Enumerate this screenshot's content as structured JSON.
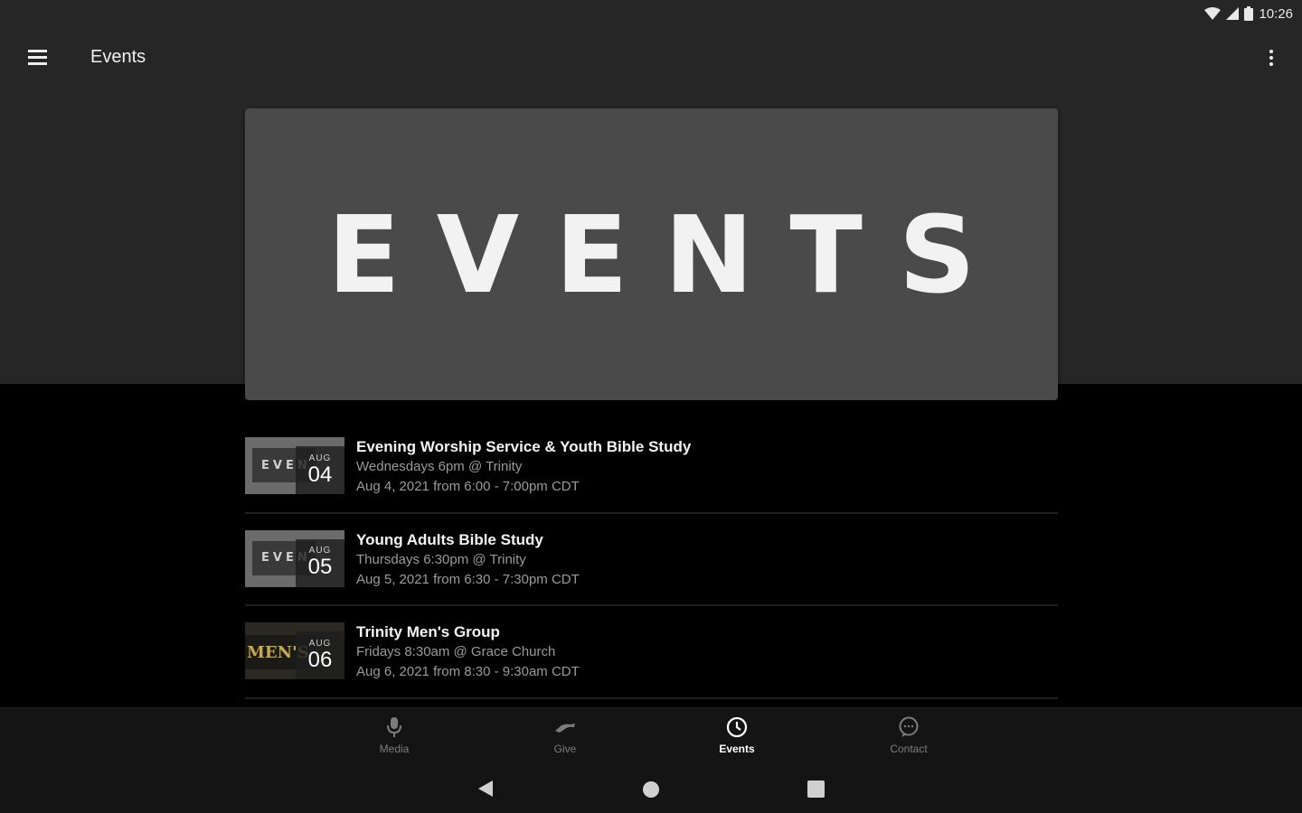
{
  "status_bar": {
    "time": "10:26",
    "icons": [
      "wifi-icon",
      "signal-icon",
      "battery-icon"
    ]
  },
  "app_bar": {
    "title": "Events",
    "menu_icon": "hamburger-menu-icon",
    "overflow_icon": "more-vert-icon"
  },
  "hero": {
    "text": "EVENTS"
  },
  "events": [
    {
      "title": "Evening Worship Service & Youth Bible Study",
      "schedule": "Wednesdays 6pm @ Trinity",
      "datetime": "Aug 4, 2021 from 6:00 - 7:00pm CDT",
      "badge_month": "AUG",
      "badge_day": "04",
      "thumb_text": "EVEN"
    },
    {
      "title": "Young Adults Bible Study",
      "schedule": "Thursdays 6:30pm @ Trinity",
      "datetime": "Aug 5, 2021 from 6:30 - 7:30pm CDT",
      "badge_month": "AUG",
      "badge_day": "05",
      "thumb_text": "EVEN"
    },
    {
      "title": "Trinity Men's Group",
      "schedule": "Fridays 8:30am @ Grace Church",
      "datetime": "Aug 6, 2021 from 8:30 - 9:30am CDT",
      "badge_month": "AUG",
      "badge_day": "06",
      "thumb_text": "MEN'S"
    }
  ],
  "bottom_nav": {
    "items": [
      {
        "label": "Media",
        "icon": "microphone-icon",
        "active": false
      },
      {
        "label": "Give",
        "icon": "give-hand-icon",
        "active": false
      },
      {
        "label": "Events",
        "icon": "clock-icon",
        "active": true
      },
      {
        "label": "Contact",
        "icon": "chat-bubble-icon",
        "active": false
      }
    ]
  },
  "system_nav": {
    "buttons": [
      "back-icon",
      "home-icon",
      "recents-icon"
    ]
  },
  "colors": {
    "top_bg": "#262626",
    "hero_bg": "#4a4a4a",
    "list_bg": "#000000",
    "nav_bg": "#141414"
  }
}
